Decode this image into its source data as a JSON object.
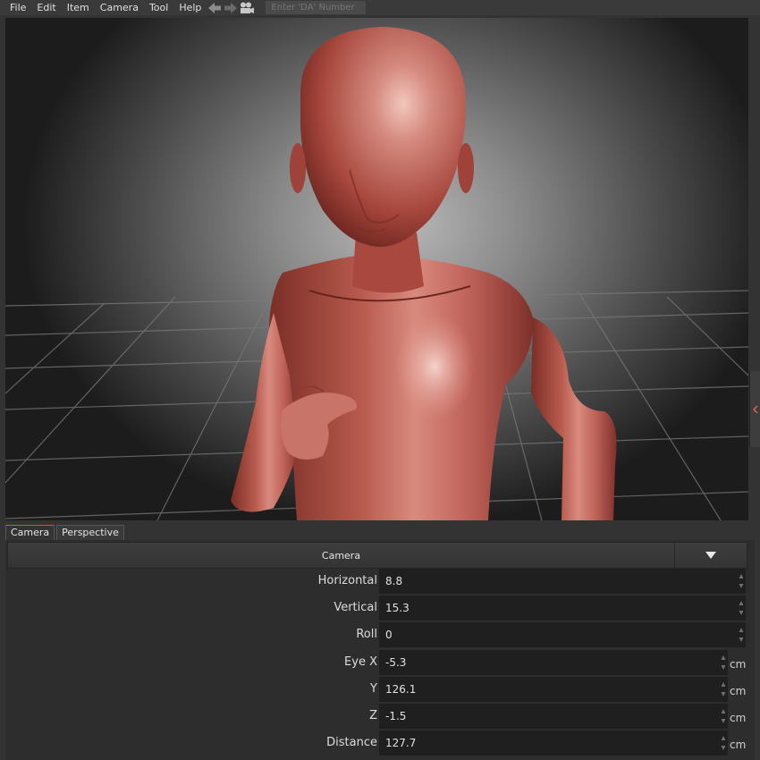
{
  "menu": [
    "File",
    "Edit",
    "Item",
    "Camera",
    "Tool",
    "Help"
  ],
  "toolbar": {
    "back_icon": "arrow-left-icon",
    "forward_icon": "arrow-right-icon",
    "camera_icon": "movie-camera-icon",
    "da_placeholder": "Enter 'DA' Number"
  },
  "tabs": [
    "Camera",
    "Perspective"
  ],
  "panel": {
    "title": "Camera",
    "rows": [
      {
        "label": "Horizontal",
        "value": "8.8",
        "unit": ""
      },
      {
        "label": "Vertical",
        "value": "15.3",
        "unit": ""
      },
      {
        "label": "Roll",
        "value": "0",
        "unit": ""
      },
      {
        "label": "Eye X",
        "value": "-5.3",
        "unit": "cm"
      },
      {
        "label": "Y",
        "value": "126.1",
        "unit": "cm"
      },
      {
        "label": "Z",
        "value": "-1.5",
        "unit": "cm"
      },
      {
        "label": "Distance",
        "value": "127.7",
        "unit": "cm"
      }
    ]
  },
  "colors": {
    "figure": "#b8544a",
    "accent": "#c05a3a"
  }
}
